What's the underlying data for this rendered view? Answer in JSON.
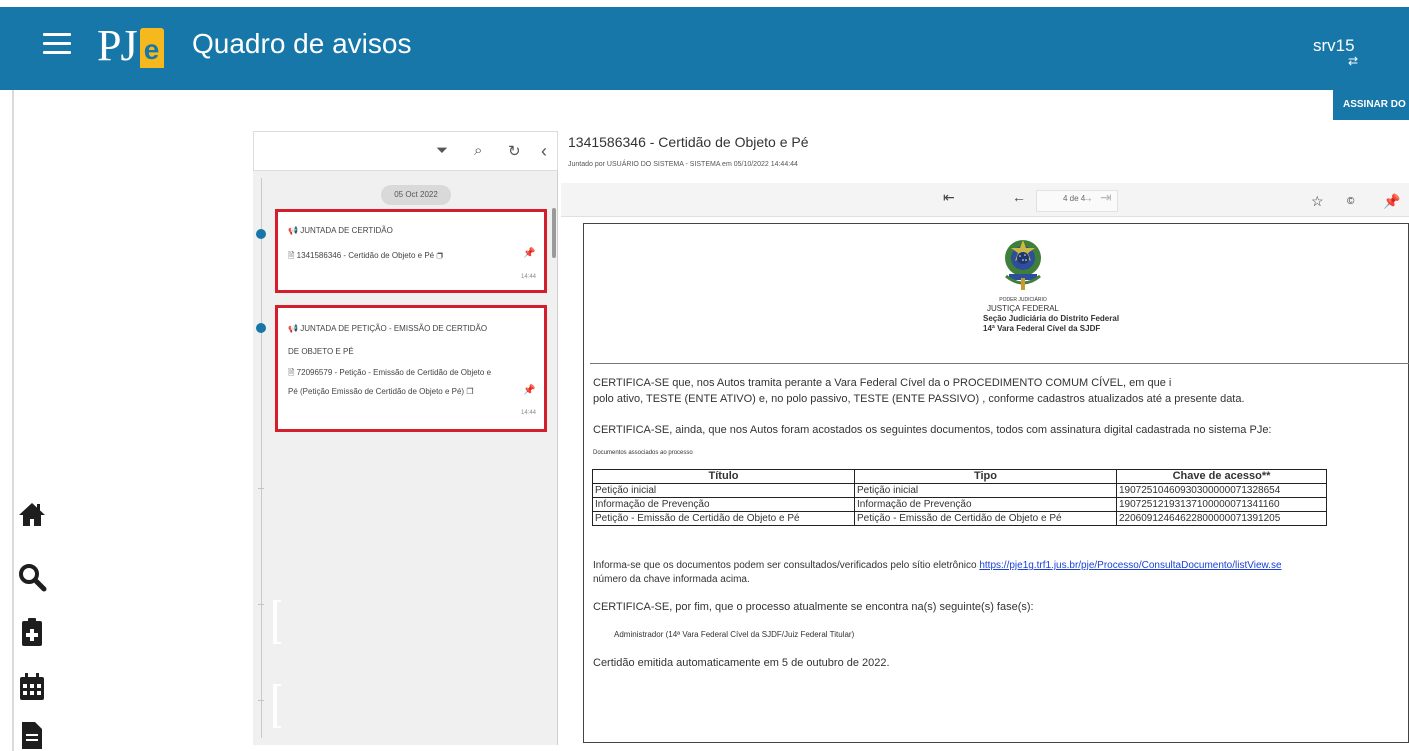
{
  "header": {
    "logo_text": "PJ",
    "logo_e": "e",
    "title": "Quadro de avisos",
    "server": "srv15"
  },
  "toolbar": {
    "assinar_label": "ASSINAR DO"
  },
  "left_rail": {
    "icons": [
      "home-icon",
      "search-icon",
      "clipboard-icon",
      "calendar-icon",
      "document-icon"
    ]
  },
  "timeline": {
    "date_badge": "05 Oct 2022",
    "events": [
      {
        "type": "JUNTADA DE CERTIDÃO",
        "doc": "1341586346 - Certidão de Objeto e Pé",
        "time": "14:44"
      },
      {
        "type_line1": "JUNTADA DE PETIÇÃO - EMISSÃO DE CERTIDÃO",
        "type_line2": "DE OBJETO E PÉ",
        "doc_line1": "72096579 - Petição - Emissão de Certidão de Objeto e",
        "doc_line2": "Pé (Petição Emissão de Certidão de Objeto e Pé)",
        "time": "14:44"
      }
    ]
  },
  "document": {
    "title": "1341586346 - Certidão de Objeto e Pé",
    "subtitle": "Juntado por USUÁRIO DO SISTEMA - SISTEMA em 05/10/2022 14:44:44",
    "page_indicator": "4 de 4",
    "header_lines": [
      "PODER JUDICIÁRIO",
      "JUSTIÇA FEDERAL",
      "Seção Judiciária do Distrito Federal",
      "14ª Vara Federal Cível da SJDF"
    ],
    "para1_line1": "CERTIFICA-SE que, nos Autos                              tramita perante a     Vara Federal Cível da          o PROCEDIMENTO COMUM CÍVEL, em que i",
    "para1_line2": "polo ativo, TESTE (ENTE ATIVO) e, no polo passivo, TESTE (ENTE PASSIVO) , conforme cadastros atualizados até a presente data.",
    "para2": "CERTIFICA-SE, ainda, que nos Autos foram acostados os seguintes documentos, todos com assinatura digital cadastrada no sistema PJe:",
    "docs_caption": "Documentos associados ao processo",
    "table": {
      "headers": [
        "Título",
        "Tipo",
        "Chave de acesso**"
      ],
      "rows": [
        [
          "Petição inicial",
          "Petição inicial",
          "19072510460930300000071328654"
        ],
        [
          "Informação de Prevenção",
          "Informação de Prevenção",
          "19072512193137100000071341160"
        ],
        [
          "Petição - Emissão de Certidão de Objeto e Pé",
          "Petição - Emissão de Certidão de Objeto e Pé",
          "22060912464622800000071391205"
        ]
      ]
    },
    "para3_start": "Informa-se que os documentos podem ser consultados/verificados pelo sítio eletrônico",
    "para3_link": "https://pje1g.trf1.jus.br/pje/Processo/ConsultaDocumento/listView.se",
    "para3_line2": "número da chave informada acima.",
    "para4": "CERTIFICA-SE, por fim, que o processo atualmente se encontra na(s) seguinte(s) fase(s):",
    "phase": "Administrador (14ª Vara Federal Cível da SJDF/Juiz Federal Titular)",
    "closing": "Certidão emitida automaticamente em 5 de outubro de 2022."
  }
}
